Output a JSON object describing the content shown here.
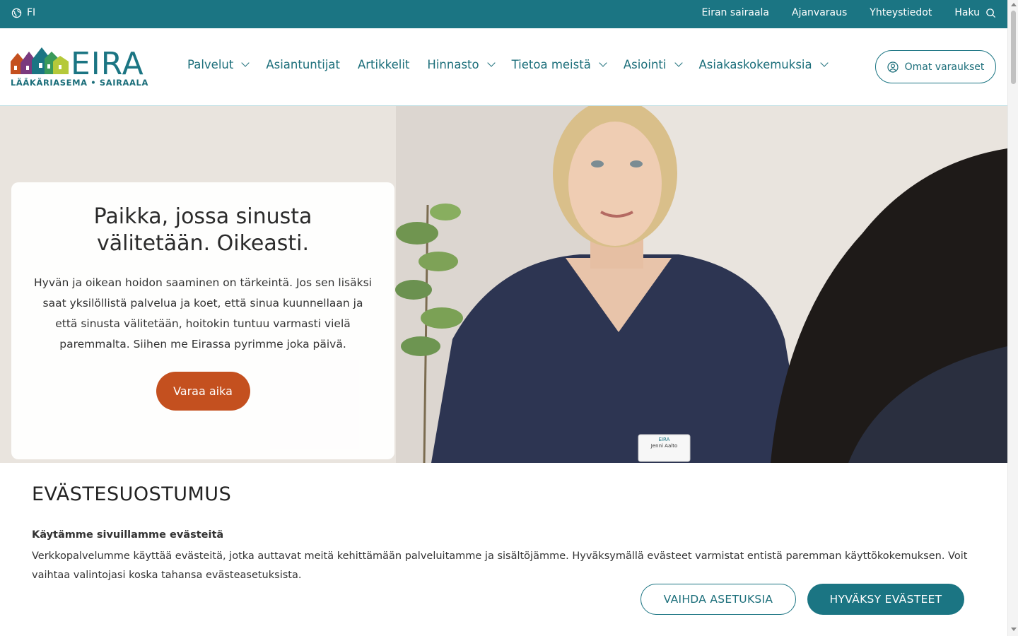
{
  "topbar": {
    "language": "FI",
    "links": [
      "Eiran sairaala",
      "Ajanvaraus",
      "Yhteystiedot"
    ],
    "search_label": "Haku"
  },
  "logo": {
    "word": "EIRA",
    "subtitle": "LÄÄKÄRIASEMA • SAIRAALA"
  },
  "nav": {
    "items": [
      {
        "label": "Palvelut",
        "dropdown": true
      },
      {
        "label": "Asiantuntijat",
        "dropdown": false
      },
      {
        "label": "Artikkelit",
        "dropdown": false
      },
      {
        "label": "Hinnasto",
        "dropdown": true
      },
      {
        "label": "Tietoa meistä",
        "dropdown": true
      },
      {
        "label": "Asiointi",
        "dropdown": true
      },
      {
        "label": "Asiakaskokemuksia",
        "dropdown": true
      }
    ],
    "account_button": "Omat varaukset"
  },
  "hero": {
    "title": "Paikka, jossa sinusta välitetään. Oikeasti.",
    "body": "Hyvän ja oikean hoidon saaminen on tärkeintä. Jos sen lisäksi saat yksilöllistä palvelua ja koet, että sinua kuunnellaan ja että sinusta välitetään, hoitokin tuntuu varmasti vielä paremmalta. Siihen me Eirassa pyrimme joka päivä.",
    "cta": "Varaa aika",
    "badge_brand": "EIRA",
    "badge_name": "Jenni Aalto"
  },
  "cookie": {
    "heading": "EVÄSTESUOSTUMUS",
    "subheading": "Käytämme sivuillamme evästeitä",
    "text": "Verkkopalvelumme käyttää evästeitä, jotka auttavat meitä kehittämään palveluitamme ja sisältöjämme. Hyväksymällä evästeet varmistat entistä paremman käyttökokemuksen. Voit vaihtaa valintojasi koska tahansa evästeasetuksista.",
    "settings_button": "VAIHDA ASETUKSIA",
    "accept_button": "HYVÄKSY EVÄSTEET"
  },
  "colors": {
    "brand_teal": "#1b7583",
    "cta_orange": "#c4501f"
  },
  "icons": [
    "globe-icon",
    "search-icon",
    "user-icon",
    "chevron-down-icon"
  ]
}
